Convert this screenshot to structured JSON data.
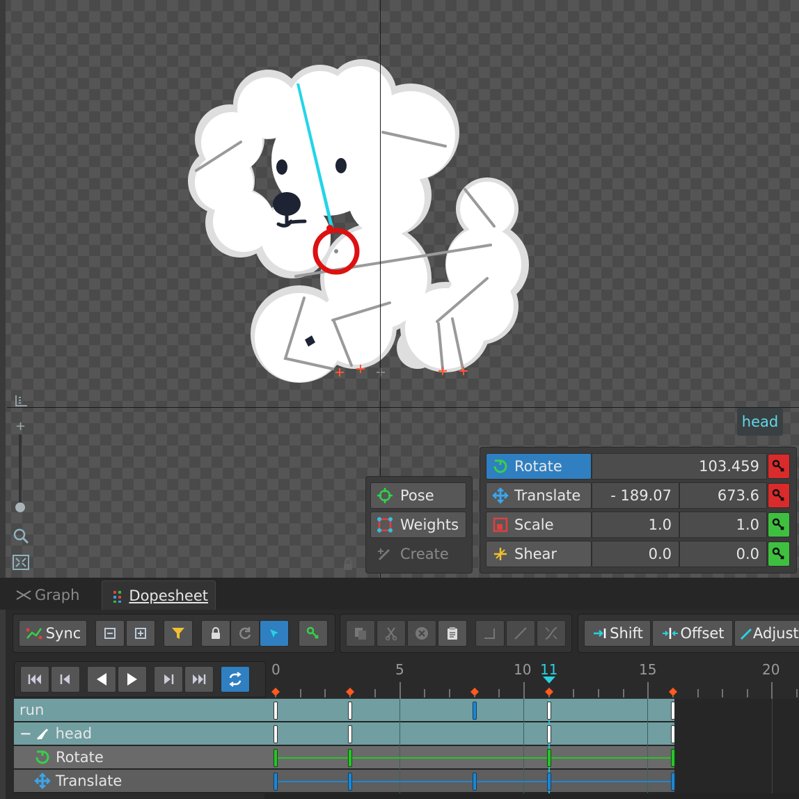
{
  "viewport": {
    "bone_tooltip": "head"
  },
  "mode_panel": {
    "pose_label": "Pose",
    "weights_label": "Weights",
    "create_label": "Create"
  },
  "transform_panel": {
    "rotate": {
      "label": "Rotate",
      "value": "103.459",
      "key_state": "red"
    },
    "translate": {
      "label": "Translate",
      "x": "- 189.07",
      "y": "673.6",
      "key_state": "red"
    },
    "scale": {
      "label": "Scale",
      "x": "1.0",
      "y": "1.0",
      "key_state": "green"
    },
    "shear": {
      "label": "Shear",
      "x": "0.0",
      "y": "0.0",
      "key_state": "green"
    }
  },
  "tabs": {
    "graph": "Graph",
    "dopesheet": "Dopesheet"
  },
  "toolbar": {
    "sync_label": "Sync",
    "shift_label": "Shift",
    "offset_label": "Offset",
    "adjust_label": "Adjust"
  },
  "timeline": {
    "current_frame": "11",
    "ruler_labels": [
      "0",
      "5",
      "10",
      "15",
      "20"
    ],
    "rows": {
      "run": "run",
      "head": "head",
      "rotate": "Rotate",
      "translate": "Translate"
    }
  },
  "colors": {
    "accent_blue": "#2f7fc1",
    "cursor_cyan": "#27d3e0",
    "key_red": "#d92b2b",
    "key_green": "#3fbf3f"
  }
}
